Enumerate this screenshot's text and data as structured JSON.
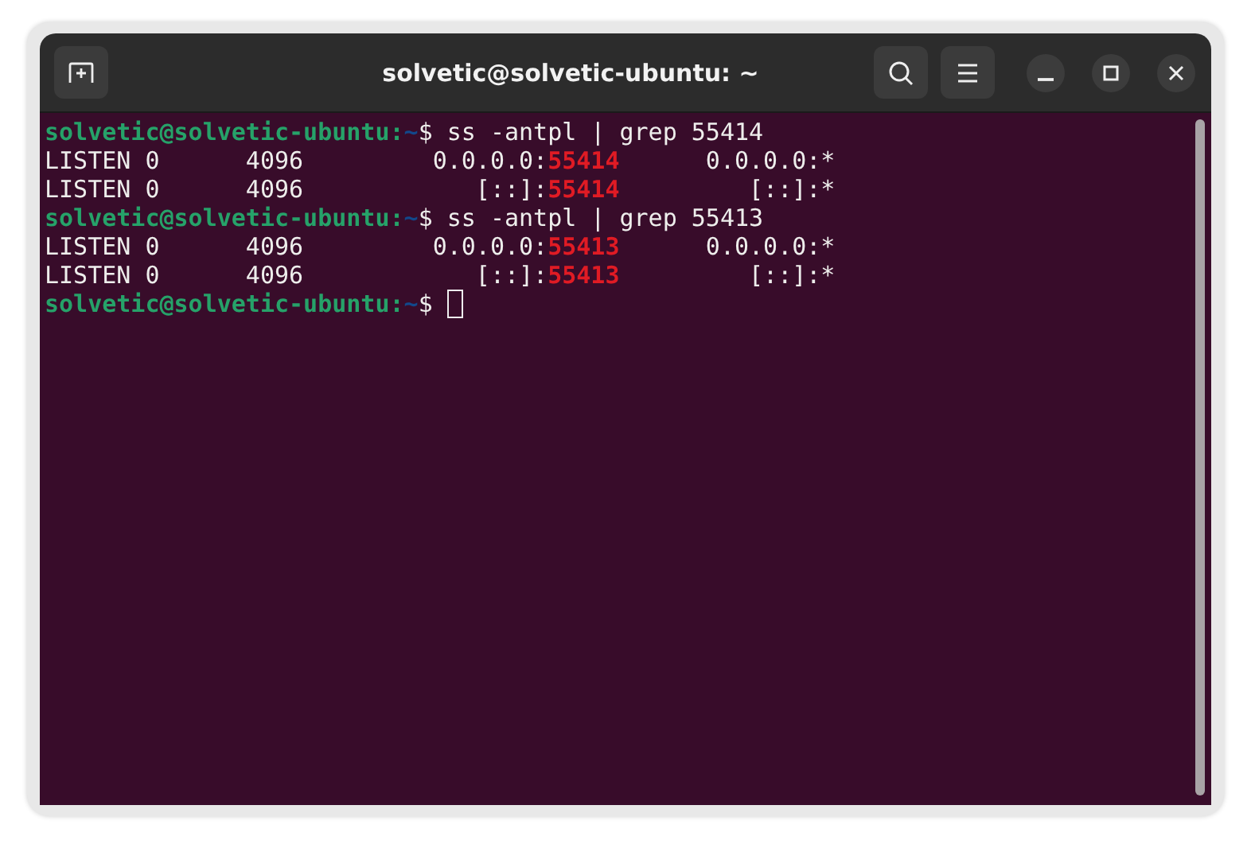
{
  "window": {
    "title": "solvetic@solvetic-ubuntu: ~"
  },
  "terminal": {
    "lines": [
      {
        "segments": [
          {
            "kind": "user",
            "text": "solvetic@solvetic-ubuntu:"
          },
          {
            "kind": "path",
            "text": "~"
          },
          {
            "kind": "plain",
            "text": "$ ss -antpl | grep 55414"
          }
        ],
        "cursor": false
      },
      {
        "segments": [
          {
            "kind": "plain",
            "text": "LISTEN 0      4096         0.0.0.0:"
          },
          {
            "kind": "match",
            "text": "55414"
          },
          {
            "kind": "plain",
            "text": "      0.0.0.0:*"
          }
        ],
        "cursor": false
      },
      {
        "segments": [
          {
            "kind": "plain",
            "text": "LISTEN 0      4096            [::]:"
          },
          {
            "kind": "match",
            "text": "55414"
          },
          {
            "kind": "plain",
            "text": "         [::]:*"
          }
        ],
        "cursor": false
      },
      {
        "segments": [
          {
            "kind": "user",
            "text": "solvetic@solvetic-ubuntu:"
          },
          {
            "kind": "path",
            "text": "~"
          },
          {
            "kind": "plain",
            "text": "$ ss -antpl | grep 55413"
          }
        ],
        "cursor": false
      },
      {
        "segments": [
          {
            "kind": "plain",
            "text": "LISTEN 0      4096         0.0.0.0:"
          },
          {
            "kind": "match",
            "text": "55413"
          },
          {
            "kind": "plain",
            "text": "      0.0.0.0:*"
          }
        ],
        "cursor": false
      },
      {
        "segments": [
          {
            "kind": "plain",
            "text": "LISTEN 0      4096            [::]:"
          },
          {
            "kind": "match",
            "text": "55413"
          },
          {
            "kind": "plain",
            "text": "         [::]:*"
          }
        ],
        "cursor": false
      },
      {
        "segments": [
          {
            "kind": "user",
            "text": "solvetic@solvetic-ubuntu:"
          },
          {
            "kind": "path",
            "text": "~"
          },
          {
            "kind": "plain",
            "text": "$ "
          }
        ],
        "cursor": true
      }
    ]
  }
}
